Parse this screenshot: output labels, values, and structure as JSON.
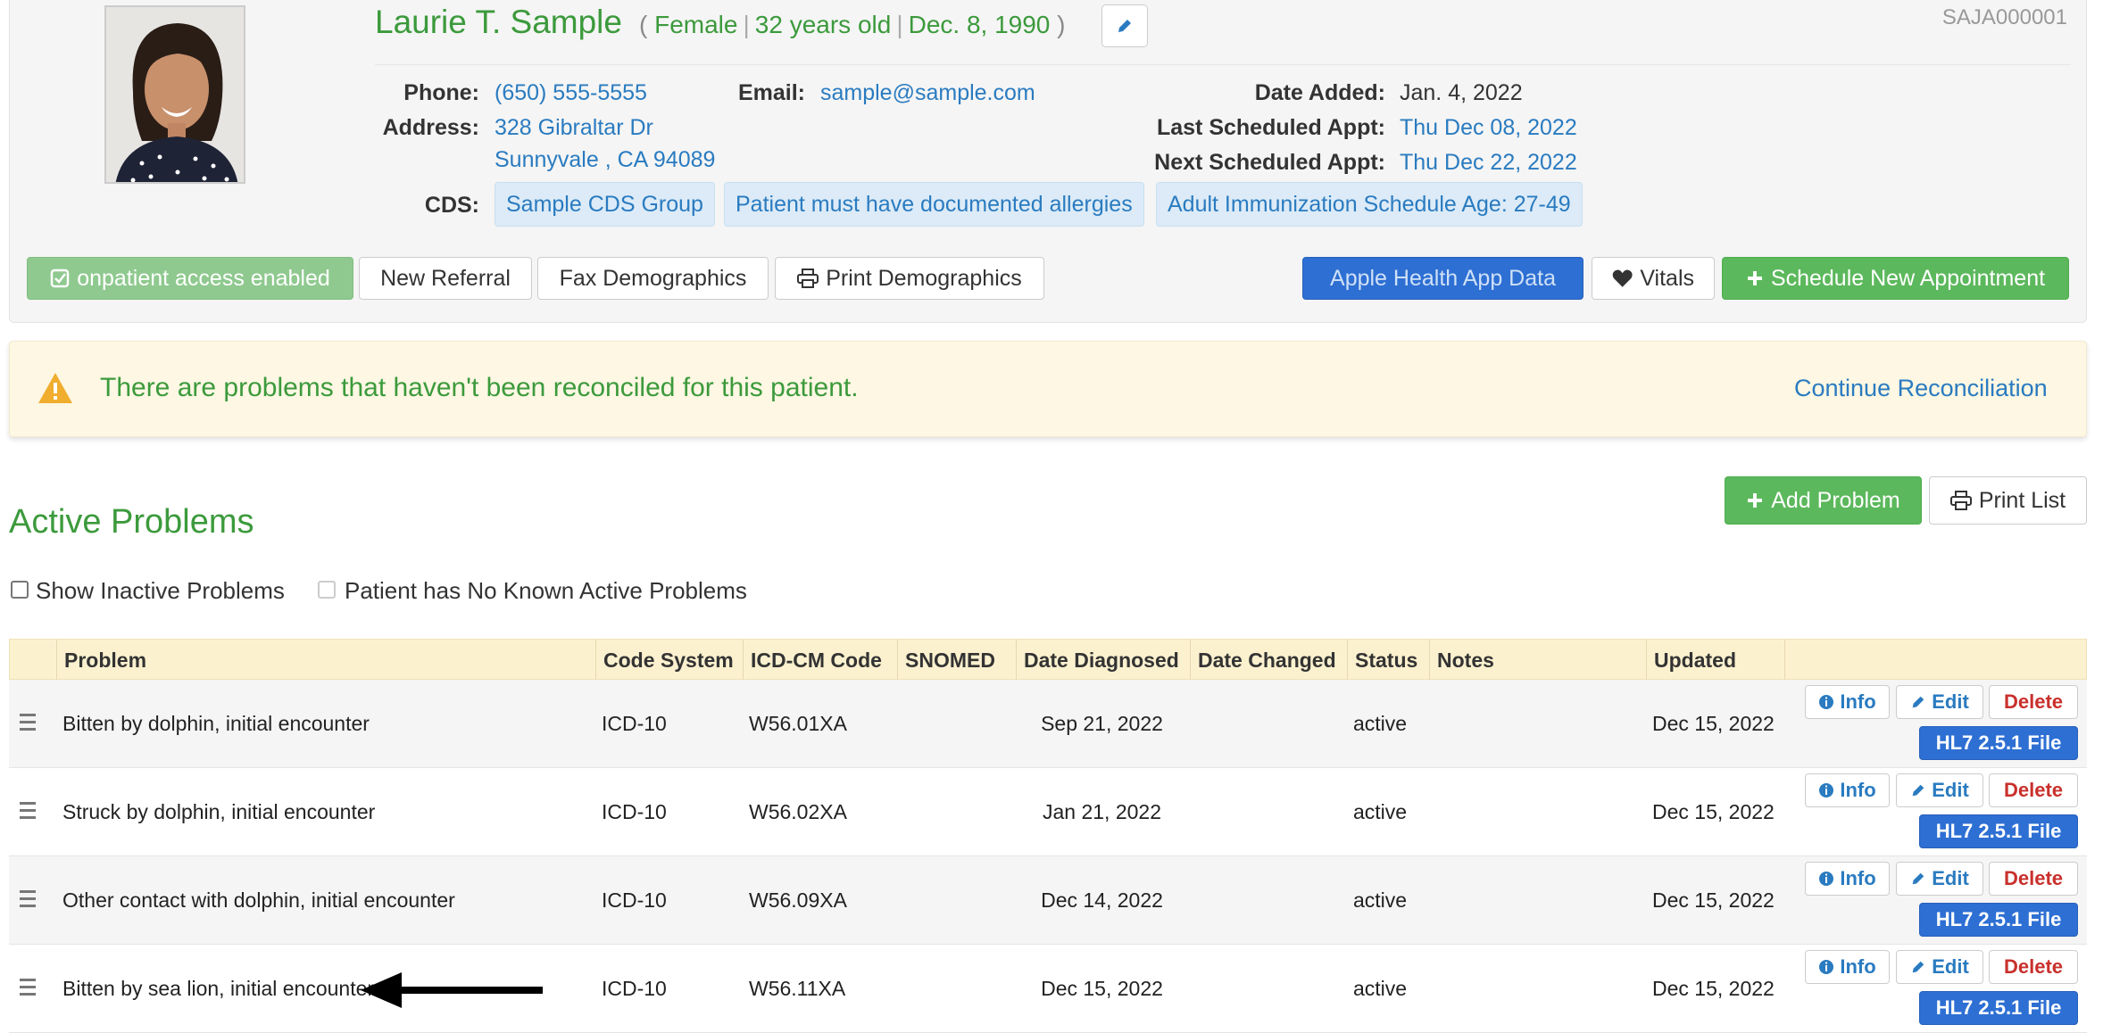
{
  "patient": {
    "name": "Laurie T. Sample",
    "gender": "Female",
    "age": "32 years old",
    "dob": "Dec. 8, 1990",
    "id": "SAJA000001",
    "phone_label": "Phone:",
    "phone": "(650) 555-5555",
    "email_label": "Email:",
    "email": "sample@sample.com",
    "address_label": "Address:",
    "address_line1": "328 Gibraltar Dr",
    "address_line2": "Sunnyvale , CA 94089",
    "date_added_label": "Date Added:",
    "date_added": "Jan. 4, 2022",
    "last_appt_label": "Last Scheduled Appt:",
    "last_appt": "Thu Dec 08, 2022",
    "next_appt_label": "Next Scheduled Appt:",
    "next_appt": "Thu Dec 22, 2022",
    "cds_label": "CDS:",
    "cds_tags": [
      "Sample CDS Group",
      "Patient must have documented allergies",
      "Adult Immunization Schedule Age: 27-49"
    ]
  },
  "actions": {
    "onpatient": "onpatient access enabled",
    "new_referral": "New Referral",
    "fax_demographics": "Fax Demographics",
    "print_demographics": "Print Demographics",
    "apple_health": "Apple Health App Data",
    "vitals": "Vitals",
    "schedule": "Schedule New Appointment"
  },
  "alert": {
    "message": "There are problems that haven't been reconciled for this patient.",
    "link": "Continue Reconciliation"
  },
  "problems": {
    "title": "Active Problems",
    "add_button": "Add Problem",
    "print_button": "Print List",
    "show_inactive": "Show Inactive Problems",
    "no_known": "Patient has No Known Active Problems",
    "columns": [
      "Problem",
      "Code System",
      "ICD-CM Code",
      "SNOMED",
      "Date Diagnosed",
      "Date Changed",
      "Status",
      "Notes",
      "Updated"
    ],
    "row_buttons": {
      "info": "Info",
      "edit": "Edit",
      "delete": "Delete",
      "hl7": "HL7 2.5.1 File"
    },
    "rows": [
      {
        "problem": "Bitten by dolphin, initial encounter",
        "code_system": "ICD-10",
        "icd": "W56.01XA",
        "snomed": "",
        "diagnosed": "Sep 21, 2022",
        "changed": "",
        "status": "active",
        "notes": "",
        "updated": "Dec 15, 2022"
      },
      {
        "problem": "Struck by dolphin, initial encounter",
        "code_system": "ICD-10",
        "icd": "W56.02XA",
        "snomed": "",
        "diagnosed": "Jan 21, 2022",
        "changed": "",
        "status": "active",
        "notes": "",
        "updated": "Dec 15, 2022"
      },
      {
        "problem": "Other contact with dolphin, initial encounter",
        "code_system": "ICD-10",
        "icd": "W56.09XA",
        "snomed": "",
        "diagnosed": "Dec 14, 2022",
        "changed": "",
        "status": "active",
        "notes": "",
        "updated": "Dec 15, 2022"
      },
      {
        "problem": "Bitten by sea lion, initial encounter",
        "code_system": "ICD-10",
        "icd": "W56.11XA",
        "snomed": "",
        "diagnosed": "Dec 15, 2022",
        "changed": "",
        "status": "active",
        "notes": "",
        "updated": "Dec 15, 2022"
      }
    ]
  },
  "colors": {
    "accent_green": "#3c9a3c",
    "link_blue": "#2a7bc0",
    "primary_blue": "#2d6fd3",
    "alert_bg": "#fdf7e3",
    "table_header_bg": "#fcf1cf"
  }
}
